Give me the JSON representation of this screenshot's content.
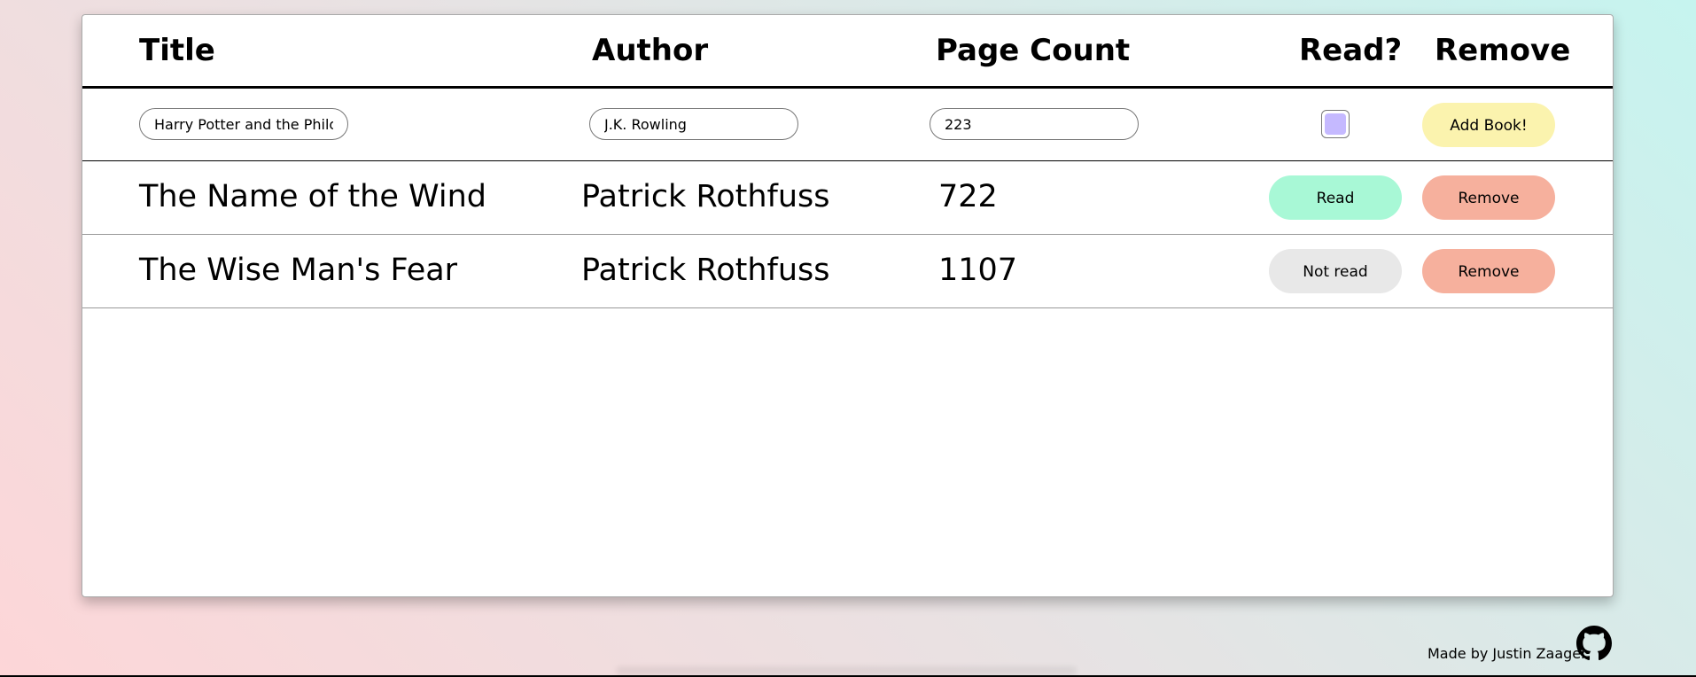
{
  "header": {
    "title": "Title",
    "author": "Author",
    "page_count": "Page Count",
    "read": "Read?",
    "remove": "Remove"
  },
  "form": {
    "title_value": "Harry Potter and the Philos",
    "author_value": "J.K. Rowling",
    "pages_value": "223",
    "read_checked": true,
    "add_label": "Add Book!"
  },
  "books": [
    {
      "title": "The Name of the Wind",
      "author": "Patrick Rothfuss",
      "pages": "722",
      "status_label": "Read",
      "remove_label": "Remove"
    },
    {
      "title": "The Wise Man's Fear",
      "author": "Patrick Rothfuss",
      "pages": "1107",
      "status_label": "Not read",
      "remove_label": "Remove"
    }
  ],
  "footer": {
    "credit": "Made by Justin Zaager",
    "icon": "github-icon"
  },
  "colors": {
    "add_button": "#fbf3ae",
    "read_button": "#a8f8d6",
    "not_read_button": "#e8e8e8",
    "remove_button": "#f6b09d",
    "checkbox_fill": "#c5b9ff",
    "gradient_left": "#fdd6d8",
    "gradient_right": "#c6f4ef"
  }
}
